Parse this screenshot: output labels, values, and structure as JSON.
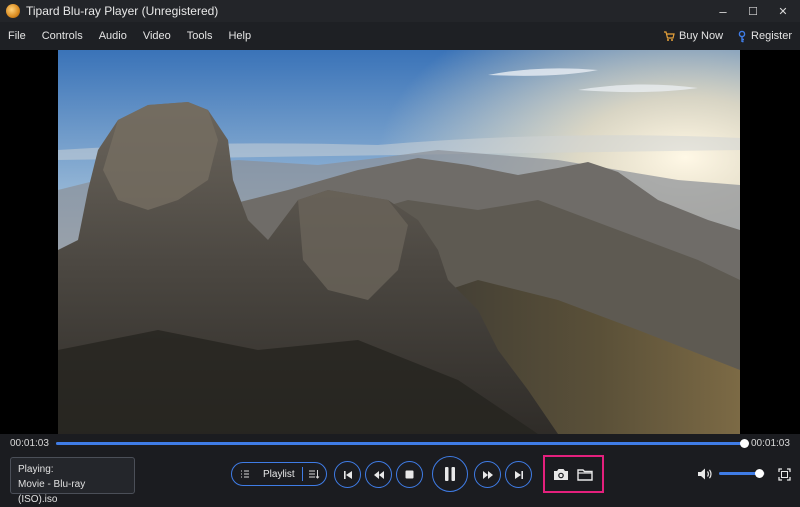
{
  "window": {
    "title": "Tipard Blu-ray Player (Unregistered)",
    "controls": {
      "minimize": "–",
      "maximize": "☐",
      "close": "✕"
    }
  },
  "menu": {
    "items": [
      "File",
      "Controls",
      "Audio",
      "Video",
      "Tools",
      "Help"
    ],
    "buy_now": "Buy Now",
    "register": "Register"
  },
  "video": {
    "scene": "mountain-sunset-aerial"
  },
  "playback": {
    "current_time": "00:01:03",
    "total_time": "00:01:03",
    "progress": 1.0
  },
  "now_playing": {
    "label": "Playing:",
    "file": "Movie - Blu-ray (ISO).iso"
  },
  "controls": {
    "playlist_label": "Playlist",
    "volume": 0.88
  },
  "colors": {
    "accent": "#3f7ce6",
    "highlight": "#e4207d",
    "background": "#1b1c20"
  },
  "icons": [
    "app-logo-icon",
    "cart-icon",
    "key-icon",
    "playlist-icon",
    "playlist-order-icon",
    "previous-icon",
    "rewind-icon",
    "stop-icon",
    "pause-icon",
    "forward-icon",
    "next-icon",
    "camera-icon",
    "folder-icon",
    "volume-icon",
    "fullscreen-icon"
  ]
}
